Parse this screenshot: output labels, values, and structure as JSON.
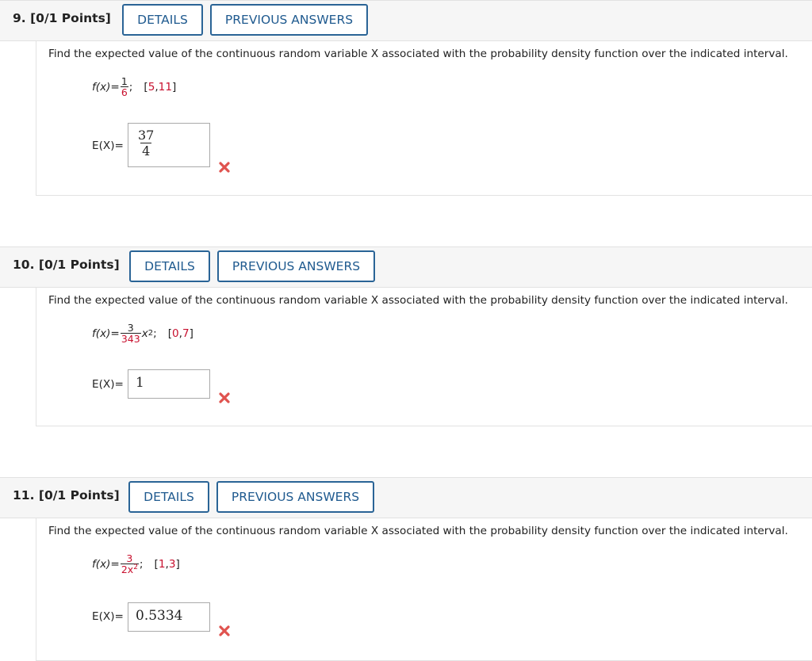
{
  "questions": [
    {
      "number": "9.",
      "points": "[0/1 Points]",
      "details_label": "DETAILS",
      "previous_label": "PREVIOUS ANSWERS",
      "prompt": "Find the expected value of the continuous random variable X associated with the probability density function over the indicated interval.",
      "formula": {
        "lhs": "f(x)=",
        "numerator": "1",
        "denominator": "6",
        "suffix": ";"
      },
      "interval": {
        "open": "[",
        "a": "5",
        "comma": ",",
        "b": "11",
        "close": "]"
      },
      "answer_label": "E(X)=",
      "answer": {
        "numerator": "37",
        "denominator": "4"
      },
      "status_icon": "x-mark-icon"
    },
    {
      "number": "10.",
      "points": "[0/1 Points]",
      "details_label": "DETAILS",
      "previous_label": "PREVIOUS ANSWERS",
      "prompt": "Find the expected value of the continuous random variable X associated with the probability density function over the indicated interval.",
      "formula": {
        "lhs": "f(x)=",
        "numerator": "3",
        "denominator": "343",
        "after": "x",
        "exponent": "2",
        "suffix": ";"
      },
      "interval": {
        "open": "[",
        "a": "0",
        "comma": ",",
        "b": "7",
        "close": "]"
      },
      "answer_label": "E(X)=",
      "answer": {
        "value": "1"
      },
      "status_icon": "x-mark-icon"
    },
    {
      "number": "11.",
      "points": "[0/1 Points]",
      "details_label": "DETAILS",
      "previous_label": "PREVIOUS ANSWERS",
      "prompt": "Find the expected value of the continuous random variable X associated with the probability density function over the indicated interval.",
      "formula": {
        "lhs": "f(x)=",
        "numerator": "3",
        "denominator": "2x",
        "denominator_exponent": "2",
        "suffix": ";"
      },
      "interval": {
        "open": "[",
        "a": "1",
        "comma": ",",
        "b": "3",
        "close": "]"
      },
      "answer_label": "E(X)=",
      "answer": {
        "value": "0.5334"
      },
      "status_icon": "x-mark-icon"
    }
  ],
  "colors": {
    "accent": "#2a6496",
    "interval_red": "#c8102e",
    "wrong": "#e0534f"
  }
}
